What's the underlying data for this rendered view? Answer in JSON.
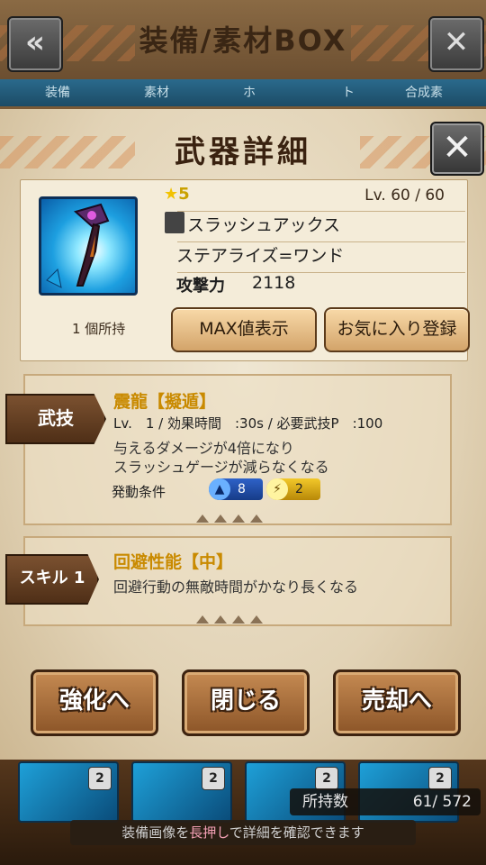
{
  "background": {
    "title": "装備/素材BOX",
    "back_icon": "back-arrow-icon",
    "close_icon": "close-x-icon",
    "tabs": [
      "装備",
      "素材",
      "ホ",
      "ト",
      "合成素"
    ],
    "thumbnails": [
      {
        "badge": "2"
      },
      {
        "badge": "2"
      },
      {
        "badge": "2"
      },
      {
        "badge": "2"
      }
    ],
    "owned_count_label": "所持数",
    "owned_count_value": "61/ 572",
    "hint_prefix": "装備画像を",
    "hint_highlight": "長押し",
    "hint_suffix": "で詳細を確認できます"
  },
  "modal": {
    "title": "武器詳細",
    "close_icon": "close-x-icon",
    "weapon": {
      "rarity": "5",
      "level": "Lv. 60 / 60",
      "type": "スラッシュアックス",
      "name": "ステアライズ=ワンド",
      "attack_label": "攻撃力",
      "attack_value": "2118",
      "owned": "1 個所持"
    },
    "buttons": {
      "max_value": "MAX値表示",
      "favorite": "お気に入り登録"
    },
    "bugi": {
      "tag": "武技",
      "name": "震龍【擬遁】",
      "stats": "Lv.　1 / 効果時間　:30s / 必要武技P　:100",
      "desc_1": "与えるダメージが4倍になり",
      "desc_2": "スラッシュゲージが減らなくなる",
      "condition_label": "発動条件",
      "cond_water": "8",
      "cond_thunder": "2"
    },
    "skill1": {
      "tag": "スキル 1",
      "name": "回避性能【中】",
      "desc": "回避行動の無敵時間がかなり長くなる"
    },
    "actions": {
      "enhance": "強化へ",
      "close": "閉じる",
      "sell": "売却へ"
    }
  }
}
